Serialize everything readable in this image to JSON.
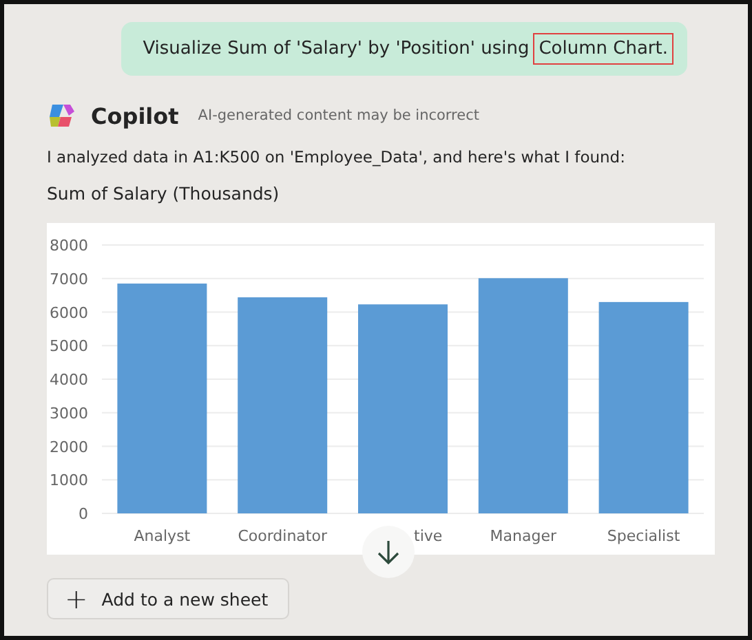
{
  "prompt": {
    "text": "Visualize Sum of 'Salary' by 'Position' using",
    "highlight": "Column Chart."
  },
  "response": {
    "name": "Copilot",
    "disclaimer": "AI-generated content may be incorrect",
    "message": "I analyzed data in A1:K500 on 'Employee_Data', and here's what I found:",
    "chart_title": "Sum of Salary (Thousands)",
    "chart_data": {
      "type": "bar",
      "categories": [
        "Analyst",
        "Coordinator",
        "tive",
        "Manager",
        "Specialist"
      ],
      "series": [
        {
          "color": "#5b9bd5",
          "values": [
            6850,
            6440,
            6230,
            7010,
            6300
          ]
        }
      ],
      "grid": true,
      "ylim": [
        0,
        8000
      ],
      "yticks": [
        0,
        1000,
        2000,
        3000,
        4000,
        5000,
        6000,
        7000,
        8000
      ]
    }
  },
  "action_button": {
    "icon": "+",
    "label": "Add to a new sheet"
  }
}
